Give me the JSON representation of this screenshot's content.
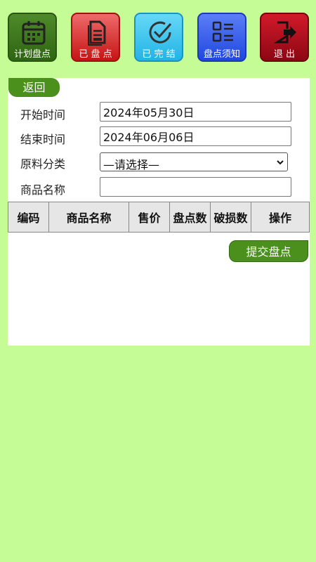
{
  "toolbar": {
    "buttons": [
      {
        "label": "计划盘点",
        "icon": "calendar-icon"
      },
      {
        "label": "已 盘 点",
        "icon": "document-icon"
      },
      {
        "label": "已 完 结",
        "icon": "check-circle-icon"
      },
      {
        "label": "盘点须知",
        "icon": "list-icon"
      },
      {
        "label": "退  出",
        "icon": "logout-icon"
      }
    ]
  },
  "back_label": "返回",
  "form": {
    "start": {
      "label": "开始时间",
      "value": "2024年05月30日"
    },
    "end": {
      "label": "结束时间",
      "value": "2024年06月06日"
    },
    "category": {
      "label": "原料分类",
      "selected": "—请选择—"
    },
    "product": {
      "label": "商品名称",
      "value": ""
    }
  },
  "table": {
    "headers": [
      "编码",
      "商品名称",
      "售价",
      "盘点数",
      "破损数",
      "操作"
    ]
  },
  "submit_label": "提交盘点",
  "colors": {
    "page_background": "#c6fc96",
    "green_accent": "#4b8f1c",
    "red_button": "#c61414",
    "cyan_button": "#22b4e4",
    "blue_button": "#1f47e0",
    "dark_red_button": "#8c0713"
  }
}
